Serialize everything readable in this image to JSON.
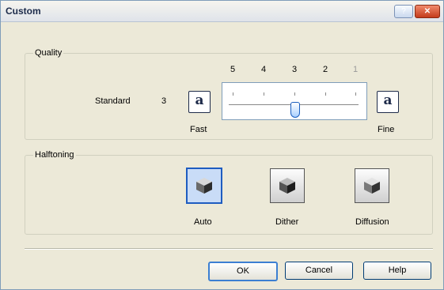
{
  "window": {
    "title": "Custom"
  },
  "titlebar_buttons": {
    "help": "?",
    "close": "✕"
  },
  "quality": {
    "label": "Quality",
    "current_label": "Standard",
    "current_value": "3",
    "scale": [
      "5",
      "4",
      "3",
      "2",
      "1"
    ],
    "slider_level": 3,
    "fast_label": "Fast",
    "fine_label": "Fine",
    "glyph": "a"
  },
  "halftoning": {
    "label": "Halftoning",
    "options": [
      {
        "label": "Auto",
        "selected": true
      },
      {
        "label": "Dither",
        "selected": false
      },
      {
        "label": "Diffusion",
        "selected": false
      }
    ]
  },
  "buttons": {
    "ok": "OK",
    "cancel": "Cancel",
    "help": "Help"
  },
  "colors": {
    "accent": "#1e5cc0",
    "close": "#c43c1c",
    "face": "#ece9d8"
  }
}
